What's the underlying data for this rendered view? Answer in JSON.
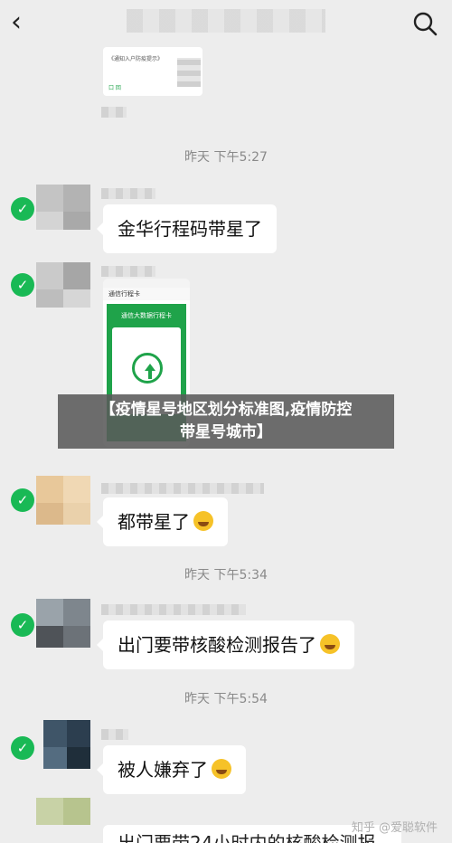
{
  "header": {
    "back_icon": "back-chevron-icon",
    "search_icon": "search-icon"
  },
  "shared_card": {
    "caption": "《通知入户防疫提示》",
    "footer": "口 回"
  },
  "timestamps": [
    "昨天 下午5:27",
    "昨天 下午5:34",
    "昨天 下午5:54"
  ],
  "messages": [
    {
      "text": "金华行程码带星了"
    },
    {
      "text": "都带星了"
    },
    {
      "text": "出门要带核酸检测报告了"
    },
    {
      "text": "被人嫌弃了"
    }
  ],
  "trip_card": {
    "header": "通信行程卡",
    "title": "通信大数据行程卡"
  },
  "partial_message": "出门要带24小时内的核酸检测报",
  "banner": {
    "line1": "【疫情星号地区划分标准图,疫情防控",
    "line2": "带星号城市】"
  },
  "watermark": "知乎 @爱聪软件",
  "colors": {
    "check_green": "#19b955",
    "card_green": "#1fa34a",
    "background": "#ededed"
  }
}
